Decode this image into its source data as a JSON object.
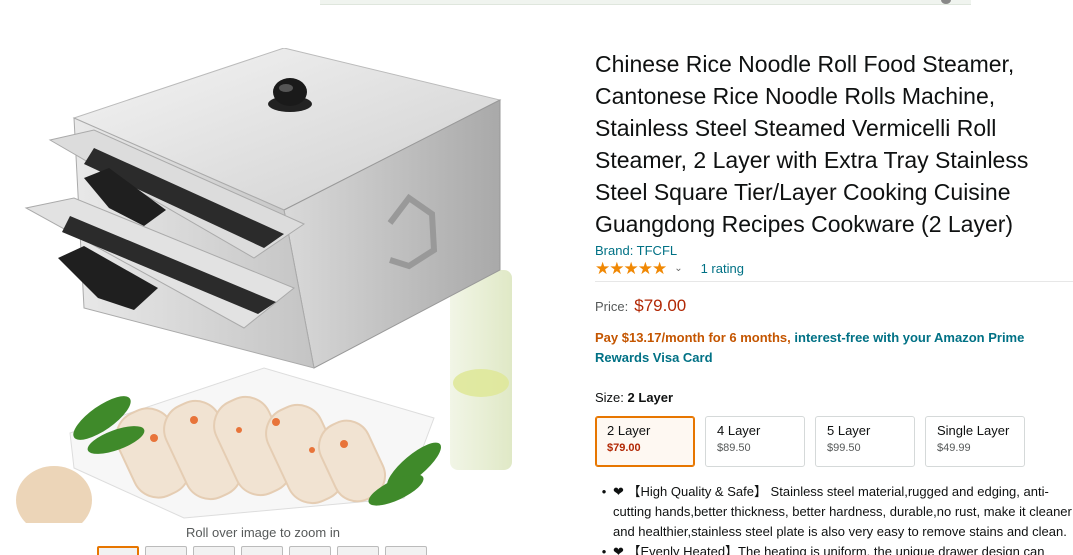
{
  "product": {
    "title": "Chinese Rice Noodle Roll Food Steamer, Cantonese Rice Noodle Rolls Machine, Stainless Steel Steamed Vermicelli Roll Steamer, 2 Layer with Extra Tray Stainless Steel Square Tier/Layer Cooking Cuisine Guangdong Recipes Cookware (2 Layer)",
    "brand": "Brand: TFCFL",
    "stars": "★★★★★",
    "rating_count": "1 rating",
    "price_label": "Price:",
    "price": "$79.00",
    "promo_orange": "Pay $13.17/month for 6 months,",
    "promo_teal": " interest-free with your Amazon Prime Rewards Visa Card"
  },
  "gallery": {
    "zoom_hint": "Roll over image to zoom in"
  },
  "size": {
    "label": "Size:",
    "selected": "2 Layer",
    "options": [
      {
        "name": "2 Layer",
        "price": "$79.00"
      },
      {
        "name": "4 Layer",
        "price": "$89.50"
      },
      {
        "name": "5 Layer",
        "price": "$99.50"
      },
      {
        "name": "Single Layer",
        "price": "$49.99"
      }
    ]
  },
  "bullets": [
    "❤ 【High Quality & Safe】 Stainless steel material,rugged and edging, anti-cutting hands,better thickness, better hardness, durable,no rust, make it cleaner and healthier,stainless steel plate is also very easy to remove stains and clean.",
    "❤ 【Evenly Heated】The heating is uniform, the unique drawer design can"
  ],
  "colors": {
    "link": "#007185",
    "price": "#B12704",
    "accent": "#e77600",
    "stars": "#F08804"
  }
}
